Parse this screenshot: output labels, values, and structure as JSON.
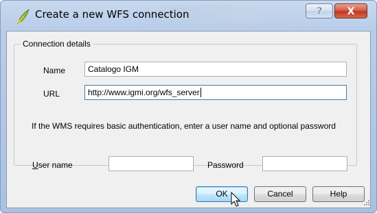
{
  "window": {
    "title": "Create a new WFS connection",
    "help_glyph": "?",
    "close_glyph": "X",
    "icon": "qgis-icon"
  },
  "group": {
    "label": "Connection details"
  },
  "form": {
    "name_label": "Name",
    "name_value": "Catalogo IGM",
    "url_label": "URL",
    "url_value": "http://www.igmi.org/wfs_server",
    "auth_note": "If the WMS requires basic authentication, enter a user name and optional password",
    "username_label_first": "U",
    "username_label_rest": "ser name",
    "username_value": "",
    "password_label": "Password",
    "password_value": ""
  },
  "buttons": {
    "ok": "OK",
    "cancel": "Cancel",
    "help": "Help"
  },
  "colors": {
    "accent": "#3d7bad",
    "close": "#c1361f"
  }
}
